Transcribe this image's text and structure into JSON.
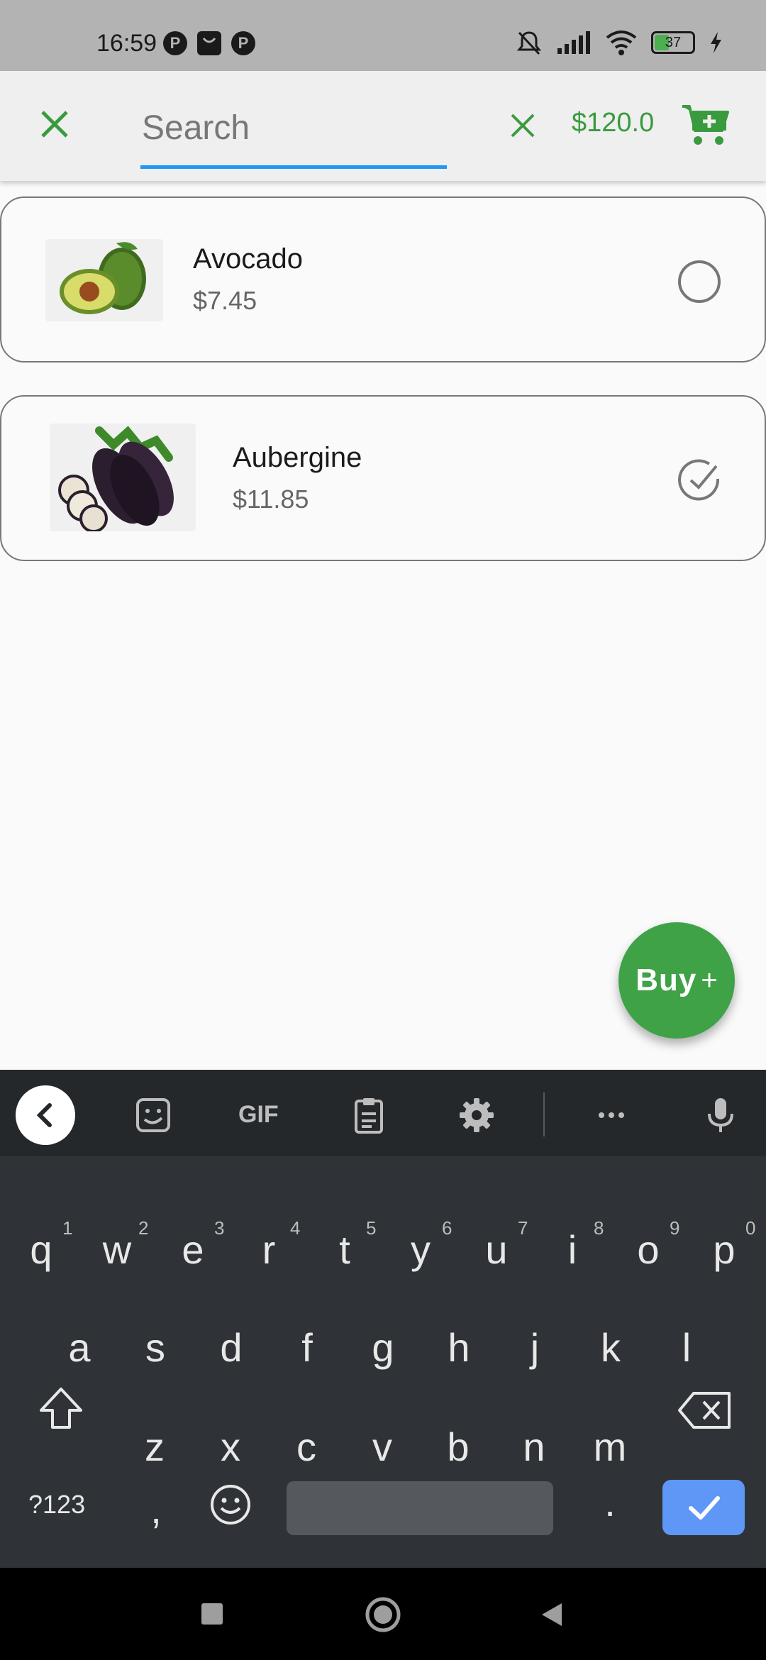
{
  "status_bar": {
    "time": "16:59",
    "battery_level": "37",
    "icons": [
      "notification-app-icon",
      "bag-icon",
      "notification-app-icon",
      "mute-icon",
      "signal-icon",
      "wifi-icon",
      "battery-icon",
      "charging-icon"
    ]
  },
  "app_bar": {
    "search_placeholder": "Search",
    "search_value": "",
    "total": "$120.0",
    "accent_color": "#3a9a3e",
    "underline_color": "#2196f3"
  },
  "products": [
    {
      "name": "Avocado",
      "price": "$7.45",
      "selected": false,
      "image": "avocado-image"
    },
    {
      "name": "Aubergine",
      "price": "$11.85",
      "selected": true,
      "image": "aubergine-image"
    }
  ],
  "fab": {
    "label": "Buy",
    "icon": "+",
    "color": "#3fa247"
  },
  "keyboard": {
    "row1": [
      "q",
      "w",
      "e",
      "r",
      "t",
      "y",
      "u",
      "i",
      "o",
      "p"
    ],
    "row1_hints": [
      "1",
      "2",
      "3",
      "4",
      "5",
      "6",
      "7",
      "8",
      "9",
      "0"
    ],
    "row2": [
      "a",
      "s",
      "d",
      "f",
      "g",
      "h",
      "j",
      "k",
      "l"
    ],
    "row3": [
      "z",
      "x",
      "c",
      "v",
      "b",
      "n",
      "m"
    ],
    "symbols_label": "?123",
    "comma": ",",
    "period": ".",
    "toolbar_gif": "GIF",
    "enter_color": "#5e97f6"
  }
}
